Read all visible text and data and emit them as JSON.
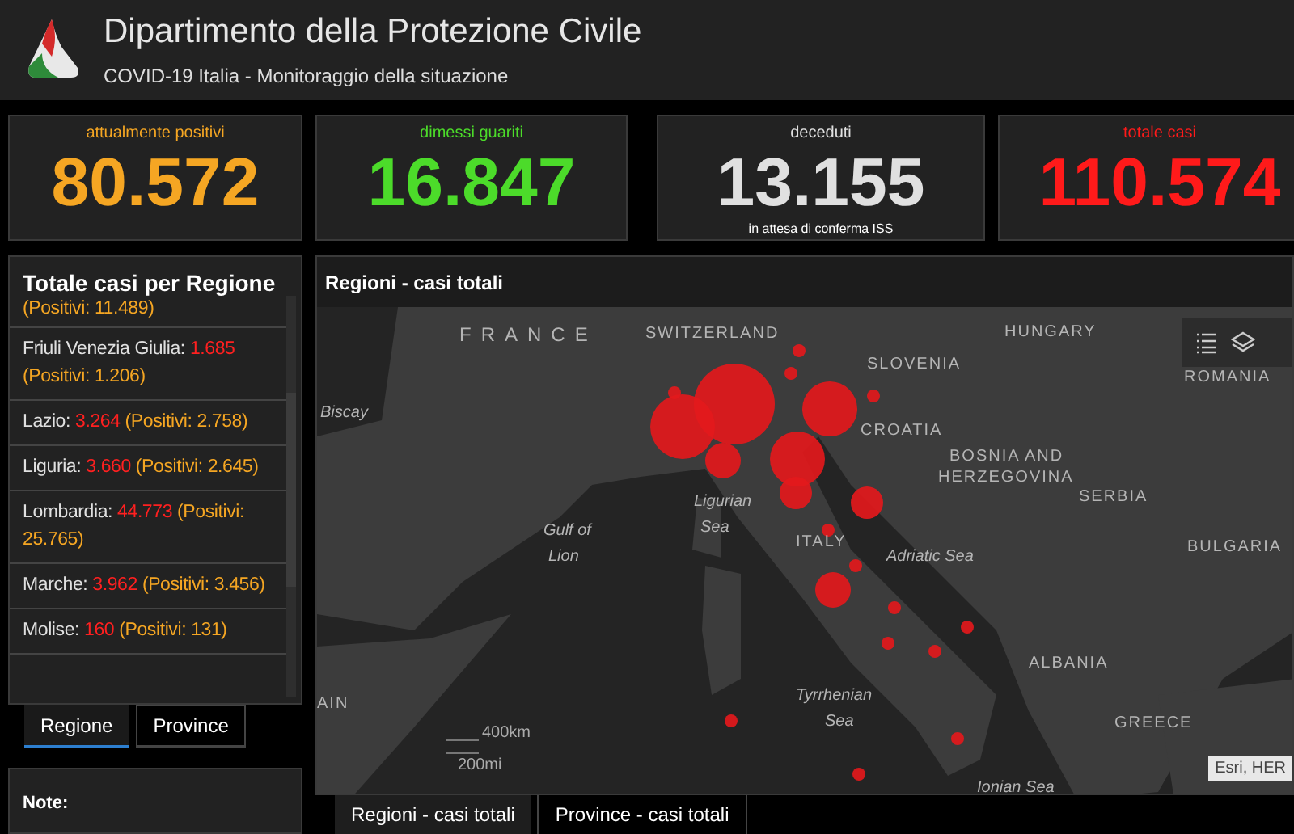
{
  "header": {
    "title": "Dipartimento della Protezione Civile",
    "subtitle": "COVID-19 Italia - Monitoraggio della situazione"
  },
  "stats": [
    {
      "label": "attualmente positivi",
      "value": "80.572",
      "color": "#f5a623"
    },
    {
      "label": "dimessi guariti",
      "value": "16.847",
      "color": "#4cdb2a"
    },
    {
      "label": "deceduti",
      "value": "13.155",
      "note": "in attesa di conferma ISS",
      "color": "#e0e0e0"
    },
    {
      "label": "totale casi",
      "value": "110.574",
      "color": "#ff1a1a"
    }
  ],
  "region_panel": {
    "title": "Totale casi per Regione",
    "items": [
      {
        "kind": "partial",
        "positivi": "(Positivi: 11.489)"
      },
      {
        "kind": "full",
        "name": "Friuli Venezia Giulia:",
        "total": "1.685",
        "positivi": "(Positivi: 1.206)"
      },
      {
        "kind": "full",
        "name": "Lazio:",
        "total": "3.264",
        "positivi": "(Positivi: 2.758)"
      },
      {
        "kind": "full",
        "name": "Liguria:",
        "total": "3.660",
        "positivi": "(Positivi: 2.645)"
      },
      {
        "kind": "full",
        "name": "Lombardia:",
        "total": "44.773",
        "positivi": "(Positivi: 25.765)"
      },
      {
        "kind": "full",
        "name": "Marche:",
        "total": "3.962",
        "positivi": "(Positivi: 3.456)"
      },
      {
        "kind": "full",
        "name": "Molise:",
        "total": "160",
        "positivi": "(Positivi: 131)"
      }
    ],
    "tabs": [
      {
        "label": "Regione",
        "selected": true
      },
      {
        "label": "Province",
        "selected": false
      }
    ]
  },
  "note_panel": {
    "title": "Note:"
  },
  "map_panel": {
    "title": "Regioni - casi totali",
    "labels": [
      "FRANCE",
      "SWITZERLAND",
      "HUNGARY",
      "SLOVENIA",
      "ROMANIA",
      "Biscay",
      "CROATIA",
      "BOSNIA AND",
      "HERZEGOVINA",
      "SERBIA",
      "Ligurian",
      "Sea",
      "Gulf of",
      "Lion",
      "ITALY",
      "Adriatic Sea",
      "BULGARIA",
      "ALBANIA",
      "AIN",
      "Tyrrhenian",
      "Sea",
      "GREECE",
      "Ionian Sea"
    ],
    "scale": [
      "400km",
      "200mi"
    ],
    "attribution": "Esri, HER",
    "tabs": [
      {
        "label": "Regioni - casi totali",
        "selected": true
      },
      {
        "label": "Province - casi totali",
        "selected": false
      }
    ]
  }
}
